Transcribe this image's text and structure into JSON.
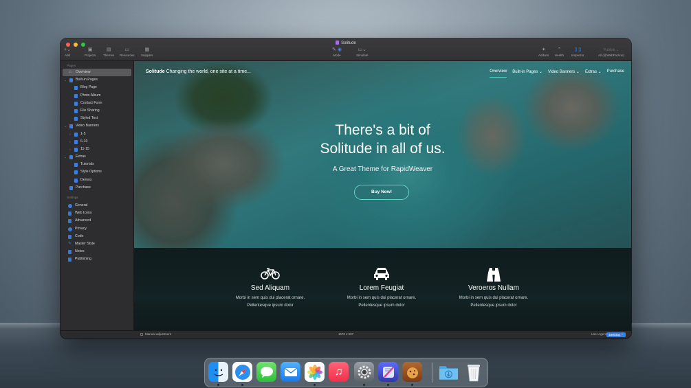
{
  "window": {
    "title": "Solitude",
    "toolbar": {
      "add": "Add",
      "projects": "Projects",
      "themes": "Themes",
      "resources": "Resources",
      "snippets": "Snippets",
      "mode": "Mode",
      "simulate": "Simulate",
      "addons": "Addons",
      "health": "Health",
      "inspector": "Inspector",
      "publish": "Publish",
      "publish_target": "All (@WebFaction)"
    }
  },
  "sidebar": {
    "pages_header": "Pages",
    "settings_header": "Settings",
    "pages": [
      {
        "label": "Overview"
      },
      {
        "label": "Built-in Pages"
      },
      {
        "label": "Blog Page"
      },
      {
        "label": "Photo Album"
      },
      {
        "label": "Contact Form"
      },
      {
        "label": "File Sharing"
      },
      {
        "label": "Styled Text"
      },
      {
        "label": "Video Banners"
      },
      {
        "label": "1-5"
      },
      {
        "label": "6-10"
      },
      {
        "label": "11-15"
      },
      {
        "label": "Extras"
      },
      {
        "label": "Tutorials"
      },
      {
        "label": "Style Options"
      },
      {
        "label": "Demos"
      },
      {
        "label": "Purchase"
      }
    ],
    "settings": [
      {
        "label": "General"
      },
      {
        "label": "Web Icons"
      },
      {
        "label": "Advanced"
      },
      {
        "label": "Privacy"
      },
      {
        "label": "Code"
      },
      {
        "label": "Master Style"
      },
      {
        "label": "Notes"
      },
      {
        "label": "Publishing"
      }
    ]
  },
  "site": {
    "logo_bold": "Solitude",
    "tagline": "Changing the world, one site at a time...",
    "nav": [
      {
        "label": "Overview"
      },
      {
        "label": "Built-in Pages ⌄"
      },
      {
        "label": "Video Banners ⌄"
      },
      {
        "label": "Extras ⌄"
      },
      {
        "label": "Purchase"
      }
    ],
    "hero_title_line1": "There's a bit of",
    "hero_title_line2": "Solitude in all of us.",
    "hero_subtitle": "A Great Theme for RapidWeaver",
    "hero_button": "Buy Now!",
    "features": [
      {
        "icon": "bicycle-icon",
        "title": "Sed Aliquam",
        "line1": "Morbi in sem quis dui placerat ornare.",
        "line2": "Pellentesque ipsum dolor"
      },
      {
        "icon": "car-icon",
        "title": "Lorem Feugiat",
        "line1": "Morbi in sem quis dui placerat ornare.",
        "line2": "Pellentesque ipsum dolor"
      },
      {
        "icon": "binoculars-icon",
        "title": "Veroeros Nullam",
        "line1": "Morbi in sem quis dui placerat ornare.",
        "line2": "Pellentesque ipsum dolor"
      }
    ]
  },
  "statusbar": {
    "manual_adjustment": "Manual adjustment",
    "dimensions": "1670 x 907",
    "user_agent_label": "User Agent",
    "user_agent_value": "Desktop ⌃"
  },
  "dock": {
    "apps": [
      "finder-icon",
      "safari-icon",
      "messages-icon",
      "mail-icon",
      "photos-icon",
      "music-icon",
      "system-settings-icon",
      "rapidweaver-icon",
      "cookie-app-icon",
      "downloads-folder-icon",
      "trash-icon"
    ]
  }
}
